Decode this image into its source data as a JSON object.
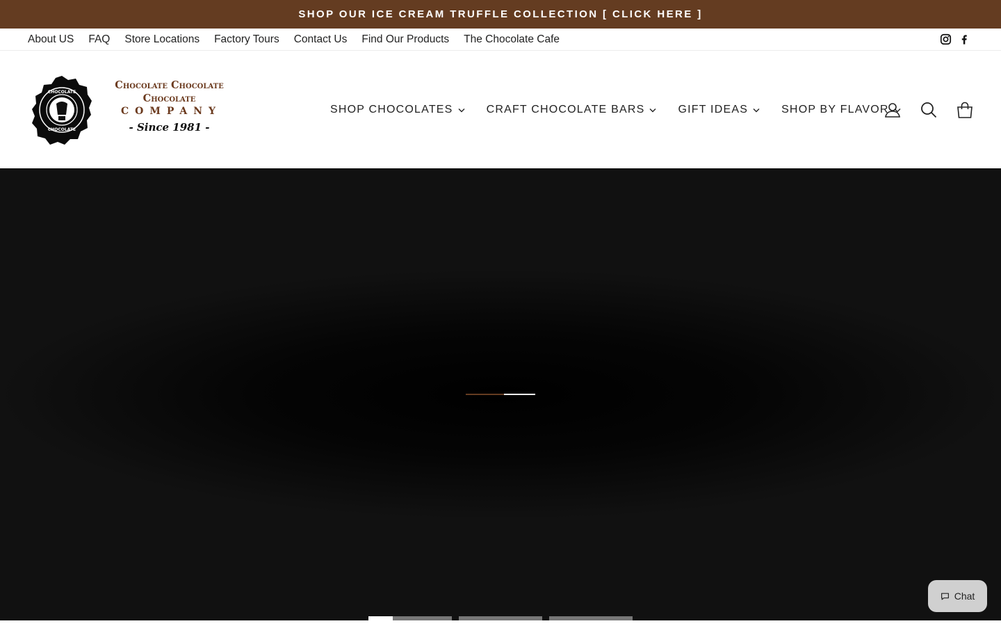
{
  "announcement": {
    "text": "SHOP OUR ICE CREAM TRUFFLE COLLECTION [ CLICK HERE ]"
  },
  "utility_nav": {
    "links": [
      "About US",
      "FAQ",
      "Store Locations",
      "Factory Tours",
      "Contact Us",
      "Find Our Products",
      "The Chocolate Cafe"
    ],
    "social_icons": [
      "instagram-icon",
      "facebook-icon"
    ]
  },
  "logo": {
    "line1": "Chocolate Chocolate",
    "line2": "Chocolate",
    "line3": "COMPANY",
    "line4": "- Since 1981 -"
  },
  "main_nav": {
    "items": [
      {
        "label": "SHOP CHOCOLATES",
        "icon": "chevron-down-icon"
      },
      {
        "label": "CRAFT CHOCOLATE BARS",
        "icon": "chevron-down-icon"
      },
      {
        "label": "GIFT IDEAS",
        "icon": "chevron-down-icon"
      },
      {
        "label": "SHOP BY FLAVOR",
        "icon": "chevron-down-icon"
      }
    ]
  },
  "header_icons": [
    "user-icon",
    "search-icon",
    "cart-icon"
  ],
  "hero": {
    "loading_progress": 0.55,
    "active_slide": 1,
    "slide_count": 3,
    "first_slide_progress": 0.29
  },
  "chat": {
    "label": "Chat",
    "icon": "chat-icon"
  },
  "colors": {
    "brand_brown": "#643c21",
    "hero_bg": "#111111",
    "chat_bg": "#d0d0d0"
  }
}
